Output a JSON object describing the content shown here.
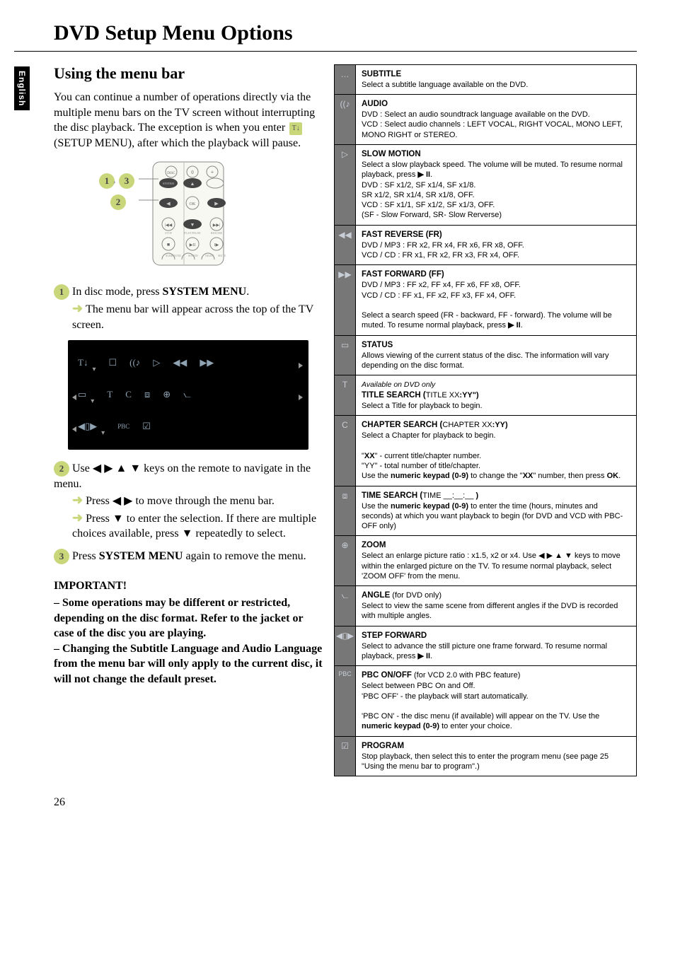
{
  "side_tab": "English",
  "title": "DVD Setup Menu Options",
  "section_heading": "Using the menu bar",
  "intro_part1": "You can continue a number of operations directly via the multiple menu bars on the TV screen without interrupting the disc playback.  The exception is when you enter ",
  "intro_setup_menu": "(SETUP MENU), after which the playback will pause.",
  "step1_label": "1",
  "step1_text_a": "In disc mode, press ",
  "step1_bold": "SYSTEM MENU",
  "step1_text_b": ".",
  "step1_sub": "The menu bar will appear across the top of the TV screen.",
  "step2_label": "2",
  "step2_text_a": "Use ◀ ▶ ▲ ▼ keys on the remote to navigate in the menu.",
  "step2_sub1": "Press ◀ ▶ to move through the menu bar.",
  "step2_sub2": "Press ▼ to enter the selection.  If there are multiple choices available, press ▼ repeatedly to select.",
  "step3_label": "3",
  "step3_a": "Press ",
  "step3_bold": "SYSTEM MENU",
  "step3_b": " again to remove the menu.",
  "important_heading": "IMPORTANT!",
  "important_body": "– Some operations may be different or restricted, depending on the disc format. Refer to the jacket or case of the disc you are playing.\n– Changing the Subtitle Language and Audio Language from the menu bar will only apply to the current disc, it will not change the default preset.",
  "page_number": "26",
  "menubar_row3": {
    "pbc": "PBC"
  },
  "options": [
    {
      "icon": "…",
      "title": "SUBTITLE",
      "body": "Select a subtitle language available on the DVD."
    },
    {
      "icon": "((♪",
      "title": "AUDIO",
      "body": "DVD :  Select an audio soundtrack language available on the DVD.\nVCD :  Select audio channels : LEFT VOCAL, RIGHT VOCAL, MONO LEFT, MONO RIGHT or STEREO."
    },
    {
      "icon": "▷",
      "title": "SLOW MOTION",
      "body": "Select a slow playback speed. The volume will be muted.  To resume normal playback, press  ▶ II.\nDVD :  SF x1/2, SF x1/4, SF x1/8.\n          SR x1/2, SR x1/4, SR x1/8, OFF.\nVCD :  SF x1/1, SF x1/2, SF x1/3, OFF.\n          (SF - Slow Forward, SR- Slow Rerverse)"
    },
    {
      "icon": "◀◀",
      "title": "FAST REVERSE (FR)",
      "body": "DVD / MP3 : FR x2, FR x4, FR x6, FR x8, OFF.\nVCD / CD : FR x1, FR x2, FR x3, FR x4, OFF."
    },
    {
      "icon": "▶▶",
      "title": "FAST FORWARD (FF)",
      "body": "DVD / MP3 : FF x2, FF x4, FF x6, FF x8, OFF.\nVCD / CD : FF x1, FF x2, FF x3, FF x4, OFF.\n\nSelect a search speed (FR - backward, FF - forward). The volume will be muted.  To resume normal playback, press  ▶ II."
    },
    {
      "icon": "▭",
      "title": "STATUS",
      "body": "Allows viewing of the current status of the disc. The information will vary depending on the disc format."
    },
    {
      "icon": "T",
      "pre": "Available on DVD only",
      "title": "TITLE SEARCH (",
      "title2": "TITLE XX",
      "title3": ":YY\")",
      "body": "Select a Title for playback to begin."
    },
    {
      "icon": "C",
      "title": "CHAPTER SEARCH (",
      "title2": "CHAPTER XX",
      "title3": ":YY)",
      "body": "Select a Chapter for playback to begin.\n\n\"XX\" - current title/chapter number.\n\"YY\" - total number of title/chapter.\nUse the numeric keypad (0-9) to change the \"XX\" number, then press OK."
    },
    {
      "icon": "⧈",
      "title": "TIME SEARCH (",
      "title2": "TIME __:__:__",
      "title3": " )",
      "body": "Use the numeric keypad (0-9) to enter the time (hours, minutes and seconds) at which you want playback to begin (for DVD and VCD with PBC-OFF only)"
    },
    {
      "icon": "⊕",
      "title": "ZOOM",
      "body": "Select an enlarge picture ratio : x1.5, x2 or x4. Use ◀ ▶ ▲ ▼ keys to move within the enlarged picture on the TV. To resume normal playback, select 'ZOOM OFF' from the menu."
    },
    {
      "icon": "⦦",
      "title": "ANGLE",
      "title_suffix": " (for DVD only)",
      "body": "Select to view the same scene from different angles if the DVD is recorded with multiple angles."
    },
    {
      "icon": "◀▯▶",
      "title": "STEP FORWARD",
      "body": "Select to advance the still picture one frame forward. To resume normal playback, press  ▶ II."
    },
    {
      "icon": "PBC",
      "title": "PBC ON/OFF",
      "title_suffix": " (for VCD 2.0 with PBC feature)",
      "body": "Select between PBC On and Off.\n'PBC OFF' - the playback will start automatically.\n\n'PBC ON' - the disc menu (if available) will appear on the TV. Use the numeric keypad (0-9) to enter your choice."
    },
    {
      "icon": "☑",
      "title": "PROGRAM",
      "body": "Stop playback, then select this to enter the program menu (see page 25 \"Using the menu bar to program\".)"
    }
  ]
}
